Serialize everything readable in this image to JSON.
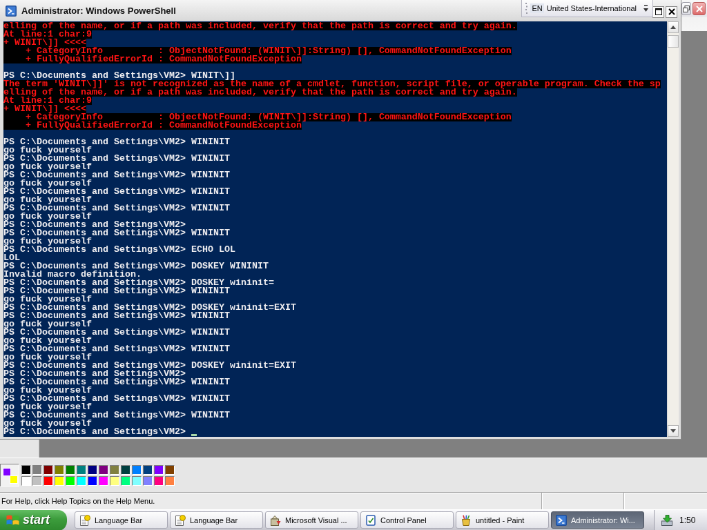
{
  "powershell_window": {
    "title": "Administrator: Windows PowerShell",
    "language_bar": {
      "language": "EN",
      "layout": "United States-International"
    },
    "console": {
      "cursor": true,
      "lines": [
        {
          "kind": "error",
          "text": "elling of the name, or if a path was included, verify that the path is correct and try again."
        },
        {
          "kind": "error",
          "text": "At line:1 char:9"
        },
        {
          "kind": "error",
          "text": "+ WINIT\\]] <<<<"
        },
        {
          "kind": "error",
          "text": "    + CategoryInfo          : ObjectNotFound: (WINIT\\]]:String) [], CommandNotFoundException"
        },
        {
          "kind": "error",
          "text": "    + FullyQualifiedErrorId : CommandNotFoundException"
        },
        {
          "kind": "blank"
        },
        {
          "kind": "output",
          "text": "PS C:\\Documents and Settings\\VM2> WINIT\\]]"
        },
        {
          "kind": "error",
          "text": "The term 'WINIT\\]]' is not recognized as the name of a cmdlet, function, script file, or operable program. Check the sp"
        },
        {
          "kind": "error",
          "text": "elling of the name, or if a path was included, verify that the path is correct and try again."
        },
        {
          "kind": "error",
          "text": "At line:1 char:9"
        },
        {
          "kind": "error",
          "text": "+ WINIT\\]] <<<<"
        },
        {
          "kind": "error",
          "text": "    + CategoryInfo          : ObjectNotFound: (WINIT\\]]:String) [], CommandNotFoundException"
        },
        {
          "kind": "error",
          "text": "    + FullyQualifiedErrorId : CommandNotFoundException"
        },
        {
          "kind": "blank"
        },
        {
          "kind": "output",
          "text": "PS C:\\Documents and Settings\\VM2> WININIT"
        },
        {
          "kind": "output",
          "text": "go fuck yourself"
        },
        {
          "kind": "output",
          "text": "PS C:\\Documents and Settings\\VM2> WININIT"
        },
        {
          "kind": "output",
          "text": "go fuck yourself"
        },
        {
          "kind": "output",
          "text": "PS C:\\Documents and Settings\\VM2> WININIT"
        },
        {
          "kind": "output",
          "text": "go fuck yourself"
        },
        {
          "kind": "output",
          "text": "PS C:\\Documents and Settings\\VM2> WININIT"
        },
        {
          "kind": "output",
          "text": "go fuck yourself"
        },
        {
          "kind": "output",
          "text": "PS C:\\Documents and Settings\\VM2> WININIT"
        },
        {
          "kind": "output",
          "text": "go fuck yourself"
        },
        {
          "kind": "output",
          "text": "PS C:\\Documents and Settings\\VM2>"
        },
        {
          "kind": "output",
          "text": "PS C:\\Documents and Settings\\VM2> WININIT"
        },
        {
          "kind": "output",
          "text": "go fuck yourself"
        },
        {
          "kind": "output",
          "text": "PS C:\\Documents and Settings\\VM2> ECHO LOL"
        },
        {
          "kind": "output",
          "text": "LOL"
        },
        {
          "kind": "output",
          "text": "PS C:\\Documents and Settings\\VM2> DOSKEY WININIT"
        },
        {
          "kind": "output",
          "text": "Invalid macro definition."
        },
        {
          "kind": "output",
          "text": "PS C:\\Documents and Settings\\VM2> DOSKEY wininit="
        },
        {
          "kind": "output",
          "text": "PS C:\\Documents and Settings\\VM2> WININIT"
        },
        {
          "kind": "output",
          "text": "go fuck yourself"
        },
        {
          "kind": "output",
          "text": "PS C:\\Documents and Settings\\VM2> DOSKEY wininit=EXIT"
        },
        {
          "kind": "output",
          "text": "PS C:\\Documents and Settings\\VM2> WININIT"
        },
        {
          "kind": "output",
          "text": "go fuck yourself"
        },
        {
          "kind": "output",
          "text": "PS C:\\Documents and Settings\\VM2> WININIT"
        },
        {
          "kind": "output",
          "text": "go fuck yourself"
        },
        {
          "kind": "output",
          "text": "PS C:\\Documents and Settings\\VM2> WININIT"
        },
        {
          "kind": "output",
          "text": "go fuck yourself"
        },
        {
          "kind": "output",
          "text": "PS C:\\Documents and Settings\\VM2> DOSKEY wininit=EXIT"
        },
        {
          "kind": "output",
          "text": "PS C:\\Documents and Settings\\VM2>"
        },
        {
          "kind": "output",
          "text": "PS C:\\Documents and Settings\\VM2> WININIT"
        },
        {
          "kind": "output",
          "text": "go fuck yourself"
        },
        {
          "kind": "output",
          "text": "PS C:\\Documents and Settings\\VM2> WININIT"
        },
        {
          "kind": "output",
          "text": "go fuck yourself"
        },
        {
          "kind": "output",
          "text": "PS C:\\Documents and Settings\\VM2> WININIT"
        },
        {
          "kind": "output",
          "text": "go fuck yourself"
        },
        {
          "kind": "output",
          "text": "PS C:\\Documents and Settings\\VM2>"
        }
      ]
    }
  },
  "paint_window": {
    "current_colors": [
      {
        "kind": "foreground",
        "color": "#8000ff"
      },
      {
        "kind": "background",
        "color": "#ffff00"
      }
    ],
    "swatches": [
      {
        "color": "#000000"
      },
      {
        "color": "#808080"
      },
      {
        "color": "#800000"
      },
      {
        "color": "#808000"
      },
      {
        "color": "#008000"
      },
      {
        "color": "#008080"
      },
      {
        "color": "#000080"
      },
      {
        "color": "#800080"
      },
      {
        "color": "#808040"
      },
      {
        "color": "#004040"
      },
      {
        "color": "#0080ff"
      },
      {
        "color": "#004080"
      },
      {
        "color": "#8000ff"
      },
      {
        "color": "#804000"
      },
      {
        "color": "#ffffff"
      },
      {
        "color": "#c0c0c0"
      },
      {
        "color": "#ff0000"
      },
      {
        "color": "#ffff00"
      },
      {
        "color": "#00ff00"
      },
      {
        "color": "#00ffff"
      },
      {
        "color": "#0000ff"
      },
      {
        "color": "#ff00ff"
      },
      {
        "color": "#ffff80"
      },
      {
        "color": "#00ff80"
      },
      {
        "color": "#80ffff"
      },
      {
        "color": "#8080ff"
      },
      {
        "color": "#ff0080"
      },
      {
        "color": "#ff8040"
      }
    ],
    "status_text": "For Help, click Help Topics on the Help Menu."
  },
  "taskbar": {
    "start_label": "start",
    "tasks": [
      {
        "label": "Language Bar",
        "kind": "help",
        "selected": false
      },
      {
        "label": "Language Bar",
        "kind": "help",
        "selected": false
      },
      {
        "label": "Microsoft Visual ...",
        "kind": "installer",
        "selected": false
      },
      {
        "label": "Control Panel",
        "kind": "panel",
        "selected": false
      },
      {
        "label": "untitled - Paint",
        "kind": "paint",
        "selected": false
      },
      {
        "label": "Administrator: Wi...",
        "kind": "shell",
        "selected": true
      }
    ],
    "clock": "1:50"
  }
}
